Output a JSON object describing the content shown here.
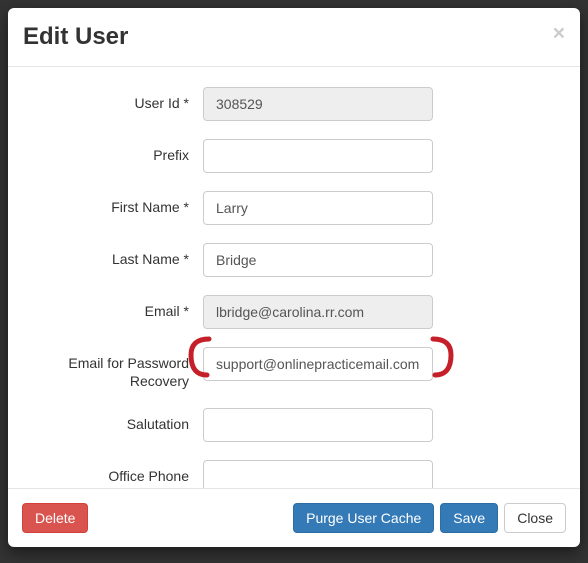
{
  "modal": {
    "title": "Edit User",
    "close_glyph": "×"
  },
  "fields": {
    "user_id": {
      "label": "User Id *",
      "value": "308529",
      "readonly": true
    },
    "prefix": {
      "label": "Prefix",
      "value": ""
    },
    "first_name": {
      "label": "First Name *",
      "value": "Larry"
    },
    "last_name": {
      "label": "Last Name *",
      "value": "Bridge"
    },
    "email": {
      "label": "Email *",
      "value": "lbridge@carolina.rr.com",
      "readonly": true
    },
    "email_recovery": {
      "label": "Email for Password Recovery",
      "value": "support@onlinepracticemail.com"
    },
    "salutation": {
      "label": "Salutation",
      "value": ""
    },
    "office_phone": {
      "label": "Office Phone",
      "value": ""
    }
  },
  "buttons": {
    "delete": "Delete",
    "purge": "Purge User Cache",
    "save": "Save",
    "close": "Close"
  },
  "annotation_color": "#c52029"
}
